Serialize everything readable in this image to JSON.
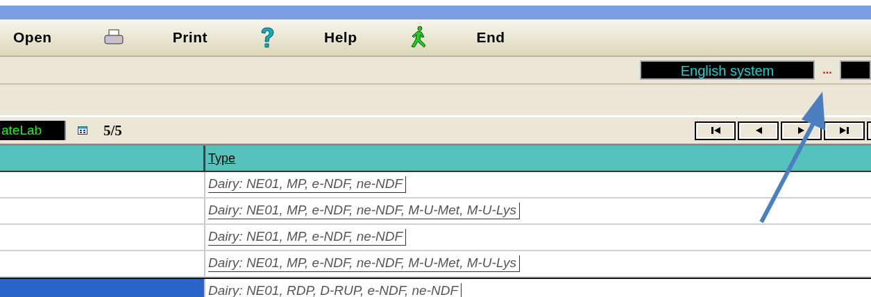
{
  "toolbar": [
    {
      "label": "Open"
    },
    {
      "label": "Print"
    },
    {
      "label": "Help"
    },
    {
      "label": "End"
    }
  ],
  "system_field": {
    "value": "English system"
  },
  "browse_button": {
    "label": "..."
  },
  "record_bar": {
    "name_field": "ateLab",
    "counter": "5/5"
  },
  "table": {
    "columns": [
      "",
      "Type"
    ],
    "rows": [
      {
        "type": "Dairy: NE01, MP, e-NDF, ne-NDF",
        "selected": false
      },
      {
        "type": "Dairy: NE01, MP, e-NDF, ne-NDF, M-U-Met, M-U-Lys",
        "selected": false
      },
      {
        "type": "Dairy: NE01, MP, e-NDF, ne-NDF",
        "selected": false
      },
      {
        "type": "Dairy: NE01, MP, e-NDF, ne-NDF, M-U-Met, M-U-Lys",
        "selected": false
      },
      {
        "type": "Dairy: NE01, RDP, D-RUP, e-NDF, ne-NDF",
        "selected": true
      }
    ]
  }
}
